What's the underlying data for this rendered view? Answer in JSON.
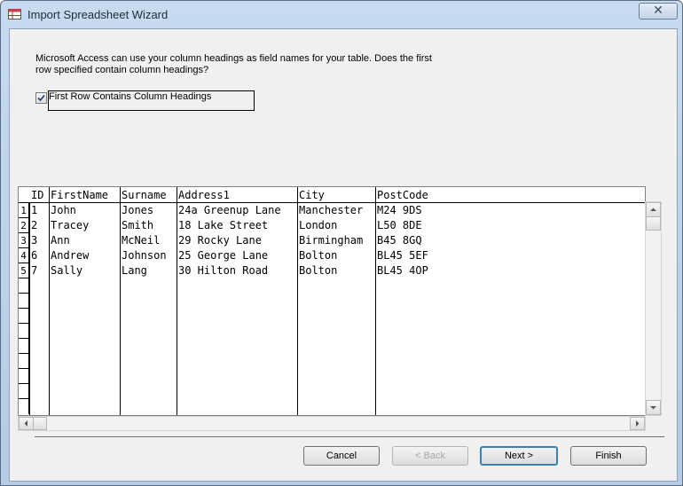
{
  "window": {
    "title": "Import Spreadsheet Wizard",
    "close_glyph": "✕"
  },
  "prompt": "Microsoft Access can use your column headings as field names for your table. Does the first row specified contain column headings?",
  "checkbox": {
    "label": "First Row Contains Column Headings",
    "checked": true
  },
  "table": {
    "columns": [
      "ID",
      "FirstName",
      "Surname",
      "Address1",
      "City",
      "PostCode"
    ],
    "row_numbers": [
      "1",
      "2",
      "3",
      "4",
      "5"
    ],
    "rows": [
      [
        "1",
        "John",
        "Jones",
        "24a Greenup Lane",
        "Manchester",
        "M24 9DS"
      ],
      [
        "2",
        "Tracey",
        "Smith",
        "18 Lake Street",
        "London",
        "L50 8DE"
      ],
      [
        "3",
        "Ann",
        "McNeil",
        "29 Rocky Lane",
        "Birmingham",
        "B45 8GQ"
      ],
      [
        "6",
        "Andrew",
        "Johnson",
        "25 George Lane",
        "Bolton",
        "BL45 5EF"
      ],
      [
        "7",
        "Sally",
        "Lang",
        "30 Hilton Road",
        "Bolton",
        "BL45 4OP"
      ]
    ]
  },
  "buttons": {
    "cancel": "Cancel",
    "back": "< Back",
    "next": "Next >",
    "finish": "Finish"
  }
}
